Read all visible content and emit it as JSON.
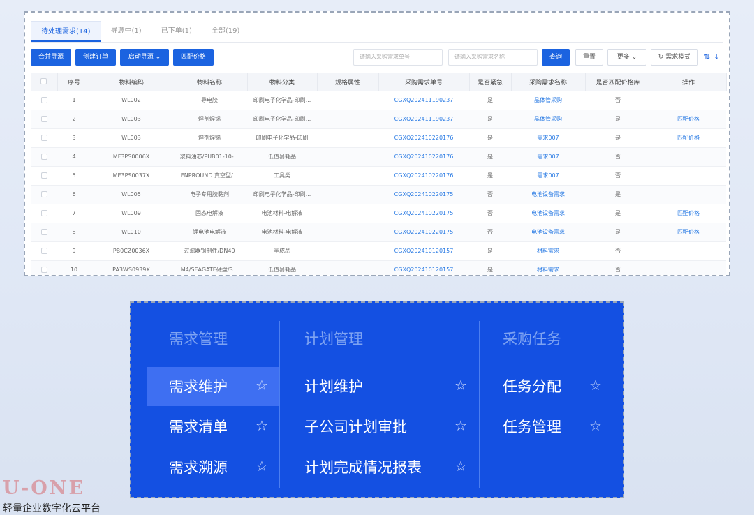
{
  "tabs": [
    {
      "label": "待处理需求(14)"
    },
    {
      "label": "寻源中(1)"
    },
    {
      "label": "已下单(1)"
    },
    {
      "label": "全部(19)"
    }
  ],
  "toolbar": {
    "merge_label": "合并寻源",
    "create_order_label": "创建订单",
    "start_sourcing_label": "启动寻源",
    "match_price_label": "匹配价格",
    "search_no_placeholder": "请输入采购需求单号",
    "search_name_placeholder": "请输入采购需求名称",
    "query_label": "查询",
    "reset_label": "重置",
    "more_label": "更多",
    "mode_label": "需求模式"
  },
  "table": {
    "headers": [
      "",
      "序号",
      "物料编码",
      "物料名称",
      "物料分类",
      "规格属性",
      "采购需求单号",
      "是否紧急",
      "采购需求名称",
      "是否匹配价格库",
      "操作"
    ],
    "rows": [
      {
        "no": "1",
        "code": "WL002",
        "name": "导电胶",
        "cat": "印刷电子化学品-印刷...",
        "spec": "",
        "req_no": "CGXQ202411190237",
        "urgent": "是",
        "req_name": "晶体管采购",
        "matched": "否",
        "op": ""
      },
      {
        "no": "2",
        "code": "WL003",
        "name": "焊剂焊锡",
        "cat": "印刷电子化学品-印刷...",
        "spec": "",
        "req_no": "CGXQ202411190237",
        "urgent": "是",
        "req_name": "晶体管采购",
        "matched": "是",
        "op": "匹配价格"
      },
      {
        "no": "3",
        "code": "WL003",
        "name": "焊剂焊锡",
        "cat": "印刷电子化学品-印刷",
        "spec": "",
        "req_no": "CGXQ202410220176",
        "urgent": "是",
        "req_name": "需求007",
        "matched": "是",
        "op": "匹配价格"
      },
      {
        "no": "4",
        "code": "MF3PS0006X",
        "name": "浆料油芯/PUB01-10-...",
        "cat": "低值易耗品",
        "spec": "",
        "req_no": "CGXQ202410220176",
        "urgent": "是",
        "req_name": "需求007",
        "matched": "否",
        "op": ""
      },
      {
        "no": "5",
        "code": "ME3PS0037X",
        "name": "ENPROUND 真空型/...",
        "cat": "工具类",
        "spec": "",
        "req_no": "CGXQ202410220176",
        "urgent": "是",
        "req_name": "需求007",
        "matched": "否",
        "op": ""
      },
      {
        "no": "6",
        "code": "WL005",
        "name": "电子专用胶黏剂",
        "cat": "印刷电子化学品-印刷...",
        "spec": "",
        "req_no": "CGXQ202410220175",
        "urgent": "否",
        "req_name": "电池设备需求",
        "matched": "是",
        "op": ""
      },
      {
        "no": "7",
        "code": "WL009",
        "name": "固态电解液",
        "cat": "电池材料-电解液",
        "spec": "",
        "req_no": "CGXQ202410220175",
        "urgent": "否",
        "req_name": "电池设备需求",
        "matched": "是",
        "op": "匹配价格"
      },
      {
        "no": "8",
        "code": "WL010",
        "name": "锂电池电解液",
        "cat": "电池材料-电解液",
        "spec": "",
        "req_no": "CGXQ202410220175",
        "urgent": "否",
        "req_name": "电池设备需求",
        "matched": "是",
        "op": "匹配价格"
      },
      {
        "no": "9",
        "code": "PB0CZ0036X",
        "name": "过滤器铜制件/DN40",
        "cat": "半成品",
        "spec": "",
        "req_no": "CGXQ202410120157",
        "urgent": "是",
        "req_name": "材料需求",
        "matched": "否",
        "op": ""
      },
      {
        "no": "10",
        "code": "PA3WS0939X",
        "name": "M4/SEAGATE硬盘/S...",
        "cat": "低值易耗品",
        "spec": "",
        "req_no": "CGXQ202410120157",
        "urgent": "是",
        "req_name": "材料需求",
        "matched": "否",
        "op": ""
      }
    ]
  },
  "menu": {
    "columns": [
      {
        "title": "需求管理",
        "items": [
          "需求维护",
          "需求清单",
          "需求溯源"
        ]
      },
      {
        "title": "计划管理",
        "items": [
          "计划维护",
          "子公司计划审批",
          "计划完成情况报表"
        ]
      },
      {
        "title": "采购任务",
        "items": [
          "任务分配",
          "任务管理"
        ]
      }
    ],
    "active_item": "需求维护",
    "colors": {
      "background": "#1450e2",
      "active": "#3e6ff2",
      "title": "#7ea3f2"
    }
  },
  "logo": {
    "mark": "U-ONE",
    "subtitle": "轻量企业数字化云平台"
  }
}
